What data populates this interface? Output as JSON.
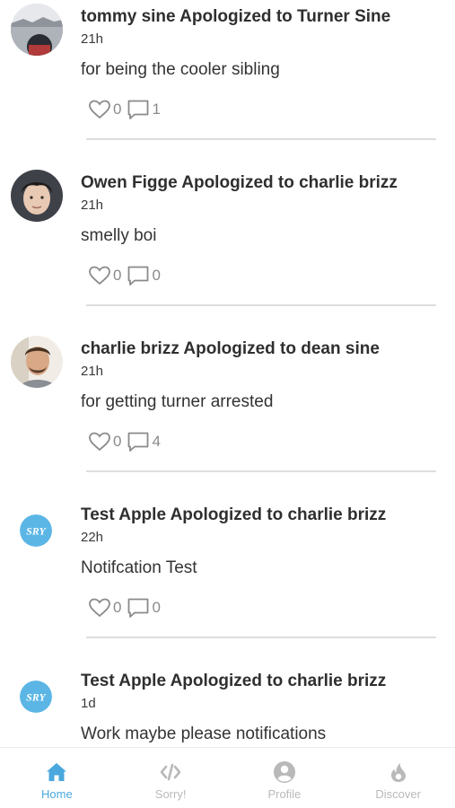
{
  "feed": {
    "posts": [
      {
        "headline": "tommy sine Apologized to Turner Sine",
        "time": "21h",
        "message": "for being the cooler sibling",
        "likes": "0",
        "comments": "1"
      },
      {
        "headline": "Owen Figge Apologized to charlie brizz",
        "time": "21h",
        "message": "smelly boi",
        "likes": "0",
        "comments": "0"
      },
      {
        "headline": "charlie brizz Apologized to dean sine",
        "time": "21h",
        "message": "for getting turner arrested",
        "likes": "0",
        "comments": "4"
      },
      {
        "headline": "Test Apple Apologized to charlie brizz",
        "time": "22h",
        "message": "Notifcation Test",
        "likes": "0",
        "comments": "0"
      },
      {
        "headline": "Test Apple Apologized to charlie brizz",
        "time": "1d",
        "message": "Work maybe please notifications",
        "likes": "",
        "comments": ""
      }
    ],
    "logo_text": "SRY"
  },
  "tabbar": {
    "home": "Home",
    "sorry": "Sorry!",
    "profile": "Profile",
    "discover": "Discover"
  },
  "colors": {
    "accent": "#4aa8de",
    "inactive": "#b9b9b9",
    "divider": "#dedede"
  },
  "icons": [
    "heart-icon",
    "comment-icon",
    "home-icon",
    "code-icon",
    "profile-icon",
    "flame-icon"
  ]
}
